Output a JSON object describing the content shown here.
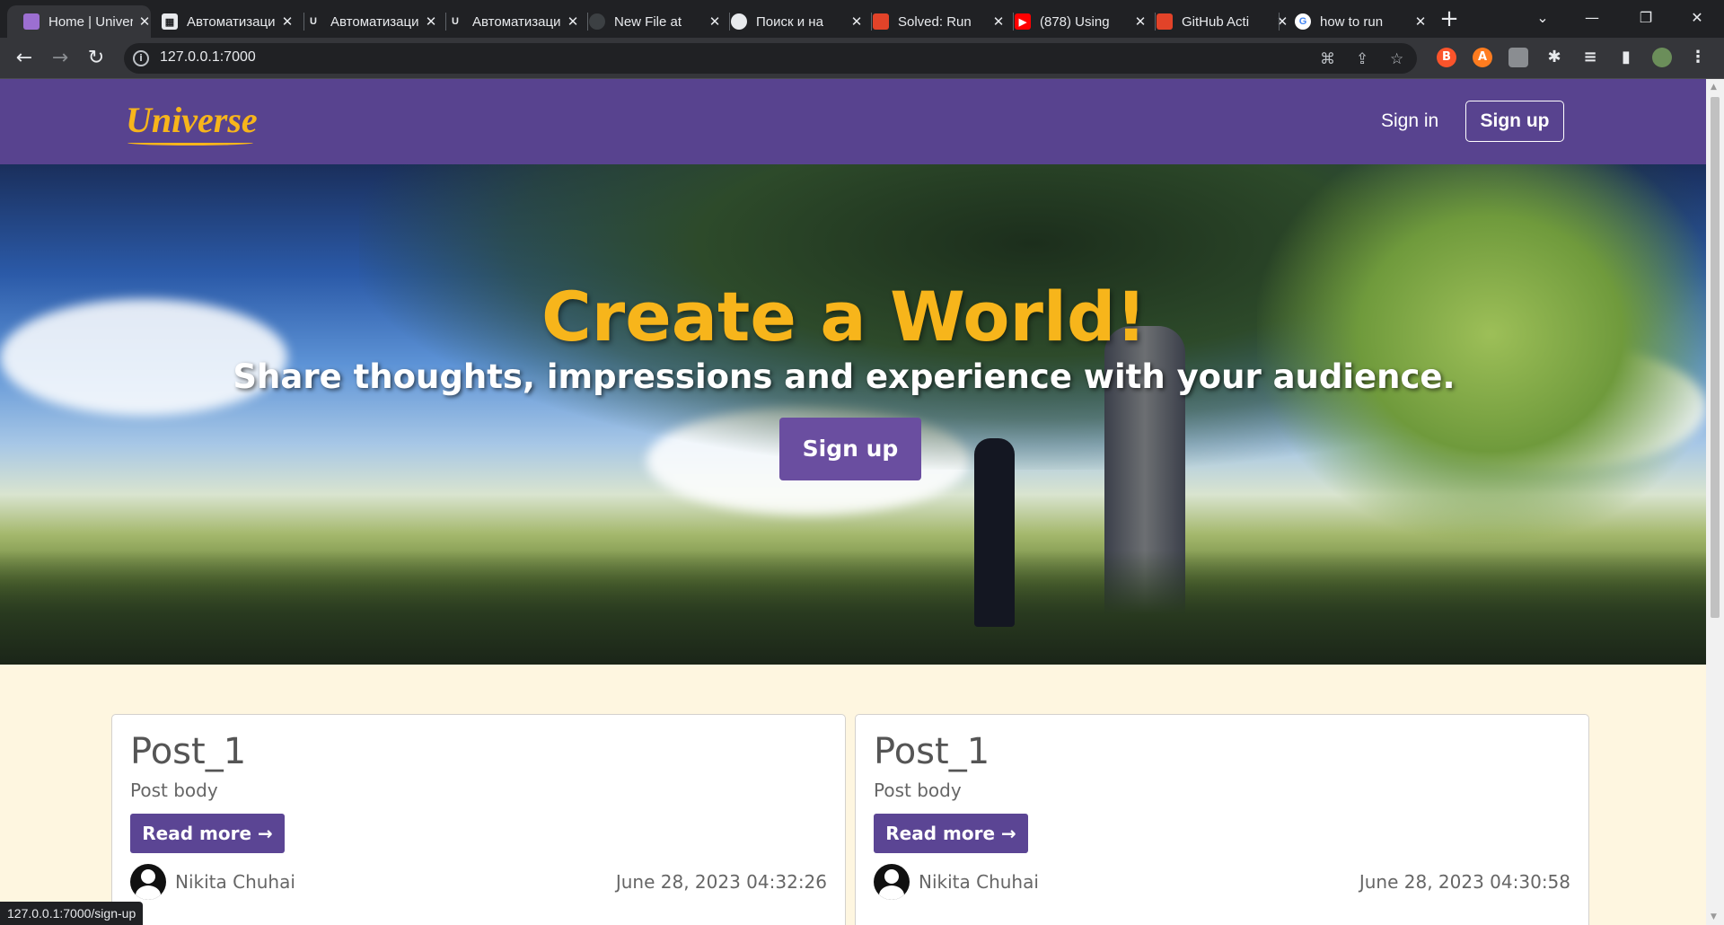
{
  "browser": {
    "tabs": [
      {
        "title": "Home | Universe",
        "favicon": "universe-favicon",
        "color": "#9c6fd1",
        "active": true
      },
      {
        "title": "Автоматизация",
        "favicon": "doc-favicon",
        "color": "#5f6368"
      },
      {
        "title": "Автоматизация",
        "favicon": "umm-favicon",
        "color": "#3c4043"
      },
      {
        "title": "Автоматизация",
        "favicon": "umm-favicon",
        "color": "#3c4043"
      },
      {
        "title": "New File at",
        "favicon": "github-favicon",
        "color": "#202124"
      },
      {
        "title": "Поиск и на",
        "favicon": "github-favicon",
        "color": "#202124"
      },
      {
        "title": "Solved: Run",
        "favicon": "gitlab-favicon",
        "color": "#e24329"
      },
      {
        "title": "(878) Using",
        "favicon": "youtube-favicon",
        "color": "#ff0000"
      },
      {
        "title": "GitHub Acti",
        "favicon": "gitlab-favicon",
        "color": "#e24329"
      },
      {
        "title": "how to run",
        "favicon": "google-favicon",
        "color": "#4285f4"
      }
    ],
    "url": "127.0.0.1:7000",
    "status_url": "127.0.0.1:7000/sign-up"
  },
  "site": {
    "logo": "Universe",
    "nav": {
      "signin": "Sign in",
      "signup": "Sign up"
    },
    "hero": {
      "title": "Create a World!",
      "subtitle": "Share thoughts, impressions and experience with your audience.",
      "cta": "Sign up"
    },
    "posts": [
      {
        "title": "Post_1",
        "body": "Post body",
        "read_more": "Read more →",
        "author": "Nikita Chuhai",
        "date": "June 28, 2023 04:32:26"
      },
      {
        "title": "Post_1",
        "body": "Post body",
        "read_more": "Read more →",
        "author": "Nikita Chuhai",
        "date": "June 28, 2023 04:30:58"
      }
    ]
  },
  "colors": {
    "brand_purple": "#58438f",
    "accent_gold": "#f7b51b",
    "page_bg": "#fef6e0"
  }
}
